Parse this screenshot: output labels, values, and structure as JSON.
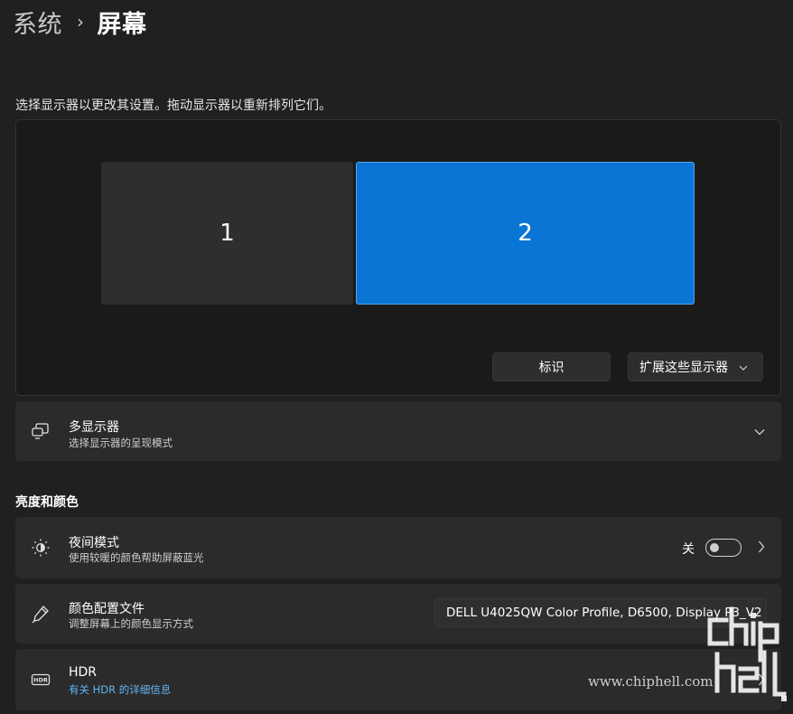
{
  "breadcrumb": {
    "parent": "系统",
    "separator": "›",
    "current": "屏幕"
  },
  "arrange": {
    "instruction": "选择显示器以更改其设置。拖动显示器以重新排列它们。",
    "monitors": [
      "1",
      "2"
    ],
    "identify_label": "标识",
    "extend_label": "扩展这些显示器"
  },
  "multi_display": {
    "title": "多显示器",
    "subtitle": "选择显示器的呈现模式"
  },
  "section_brightness": "亮度和颜色",
  "night_light": {
    "title": "夜间模式",
    "subtitle": "使用较暖的颜色帮助屏蔽蓝光",
    "state_label": "关",
    "enabled": false
  },
  "color_profile": {
    "title": "颜色配置文件",
    "subtitle": "调整屏幕上的颜色显示方式",
    "value": "DELL U4025QW Color Profile, D6500, Display P3_V2"
  },
  "hdr": {
    "title": "HDR",
    "link": "有关 HDR 的详细信息"
  },
  "watermark": {
    "text": "www.chiphell.com",
    "logo": "chip hell"
  },
  "colors": {
    "accent": "#0a75d4",
    "background": "#202020",
    "card": "#2b2b2b",
    "link": "#63b5f5"
  }
}
